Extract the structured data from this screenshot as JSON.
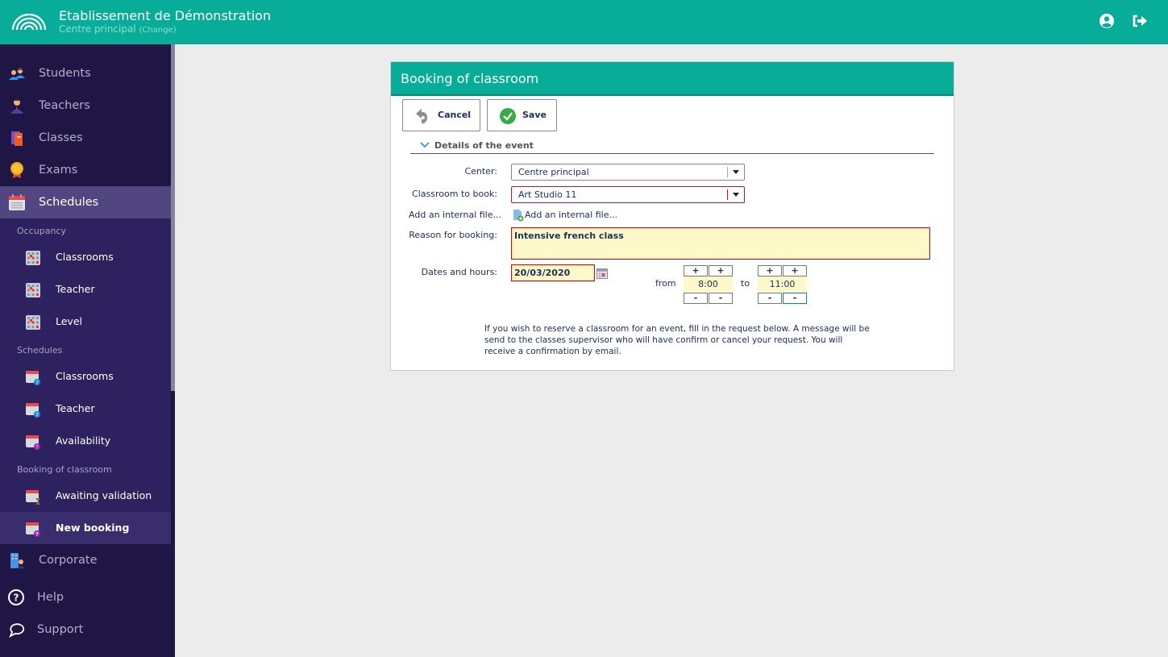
{
  "header": {
    "title": "Etablissement de Démonstration",
    "subtitle": "Centre principal",
    "change_link": "(Change)",
    "icons": [
      "user-circle-icon",
      "logout-icon"
    ]
  },
  "sidebar": {
    "main_items": [
      {
        "label": "Students",
        "icon": "students-icon"
      },
      {
        "label": "Teachers",
        "icon": "teacher-icon"
      },
      {
        "label": "Classes",
        "icon": "book-icon"
      },
      {
        "label": "Exams",
        "icon": "medal-icon"
      },
      {
        "label": "Schedules",
        "icon": "calendar-icon",
        "active": true
      }
    ],
    "sections": [
      {
        "title": "Occupancy",
        "items": [
          {
            "label": "Classrooms"
          },
          {
            "label": "Teacher"
          },
          {
            "label": "Level"
          }
        ]
      },
      {
        "title": "Schedules",
        "items": [
          {
            "label": "Classrooms"
          },
          {
            "label": "Teacher"
          },
          {
            "label": "Availability"
          }
        ]
      },
      {
        "title": "Booking of classroom",
        "items": [
          {
            "label": "Awaiting validation"
          },
          {
            "label": "New booking",
            "active": true
          }
        ]
      }
    ],
    "bottom_items": [
      {
        "label": "Corporate",
        "icon": "building-icon"
      },
      {
        "label": "Help",
        "icon": "help-icon"
      },
      {
        "label": "Support",
        "icon": "chat-icon"
      }
    ]
  },
  "panel": {
    "title": "Booking of classroom",
    "cancel_label": "Cancel",
    "save_label": "Save",
    "section_title": "Details of the event",
    "fields": {
      "center_label": "Center:",
      "center_value": "Centre principal",
      "classroom_label": "Classroom to book:",
      "classroom_value": "Art Studio 11",
      "file_label": "Add an internal file...",
      "file_link": "Add an internal file...",
      "reason_label": "Reason for booking:",
      "reason_value": "Intensive french class",
      "dates_label": "Dates and hours:",
      "date_value": "20/03/2020",
      "from_label": "from",
      "from_value": "8:00",
      "to_label": "to",
      "to_value": "11:00",
      "plus": "+",
      "minus": "-"
    },
    "info_text": "If you wish to reserve a classroom for an event, fill in the request below. A message will be send to the classes supervisor who will have confirm or cancel your request. You will receive a confirmation by email."
  },
  "colors": {
    "brand": "#07ad99",
    "sidebar": "#1f1646",
    "error": "#d00000",
    "input_bg": "#fff9c9"
  }
}
